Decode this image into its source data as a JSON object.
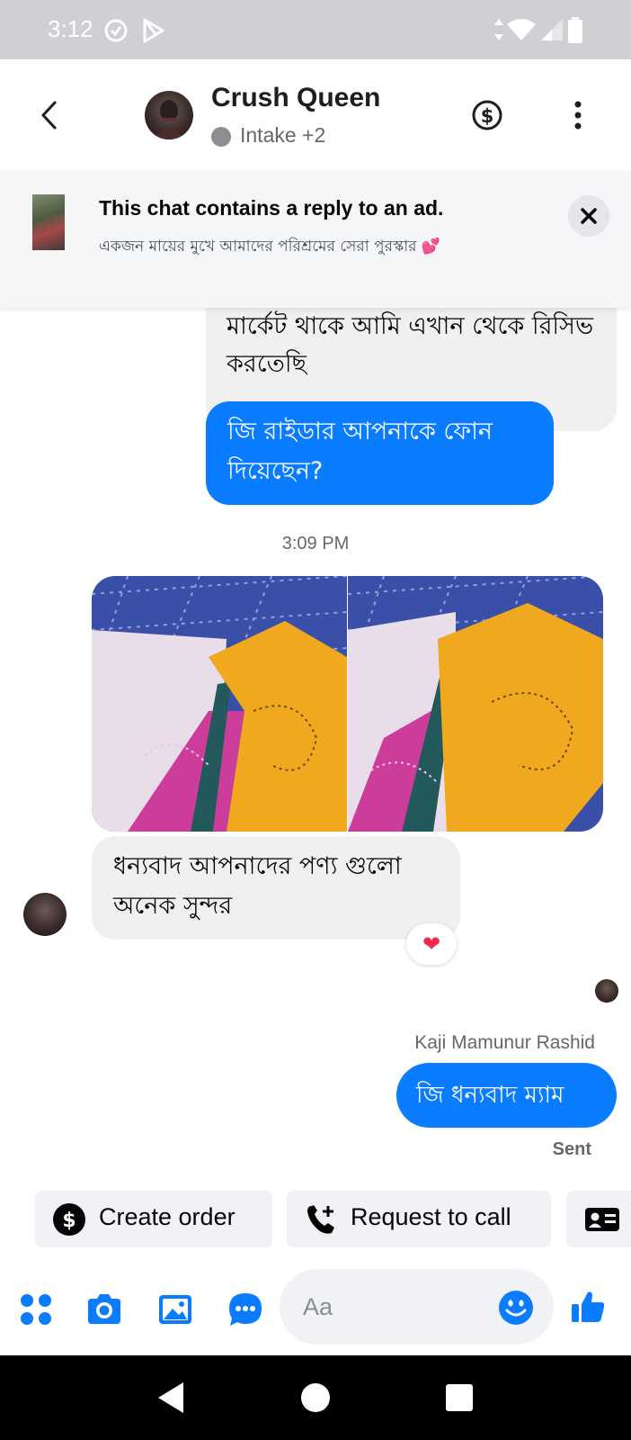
{
  "status_bar": {
    "time": "3:12",
    "icons": [
      "sync-icon",
      "play-store-icon",
      "data-arrows-icon",
      "wifi-icon",
      "signal-icon",
      "battery-icon"
    ]
  },
  "header": {
    "title": "Crush Queen",
    "subtitle": "Intake +2",
    "icons": [
      "back-icon",
      "dollar-icon",
      "more-vert-icon"
    ]
  },
  "ad_banner": {
    "title": "This chat contains a reply to an ad.",
    "description": "একজন মায়ের মুখে আমাদের পরিশ্রমের সেরা পুরস্কার 💕"
  },
  "messages": {
    "incoming_1": "মার্কেট থাকে আমি এখান থেকে রিসিভ করতেছি",
    "outgoing_1": "জি রাইডার আপনাকে ফোন দিয়েছেন?",
    "timestamp": "3:09 PM",
    "incoming_2": "ধন্যবাদ আপনাদের পণ্য গুলো অনেক সুন্দর",
    "reaction": "❤",
    "sender_name": "Kaji Mamunur Rashid",
    "outgoing_2": "জি ধন্যবাদ ম্যাম",
    "sent_status": "Sent"
  },
  "quick_actions": {
    "create_order": "Create order",
    "request_call": "Request to call"
  },
  "composer": {
    "placeholder": "Aa",
    "icons": [
      "apps-icon",
      "camera-icon",
      "gallery-icon",
      "chat-bubble-icon",
      "emoji-icon",
      "like-icon"
    ]
  },
  "colors": {
    "accent": "#0a7cff",
    "incoming_bubble": "#f0f0f0",
    "status_bar": "#cfd0d4",
    "nav_bar": "#000000"
  }
}
